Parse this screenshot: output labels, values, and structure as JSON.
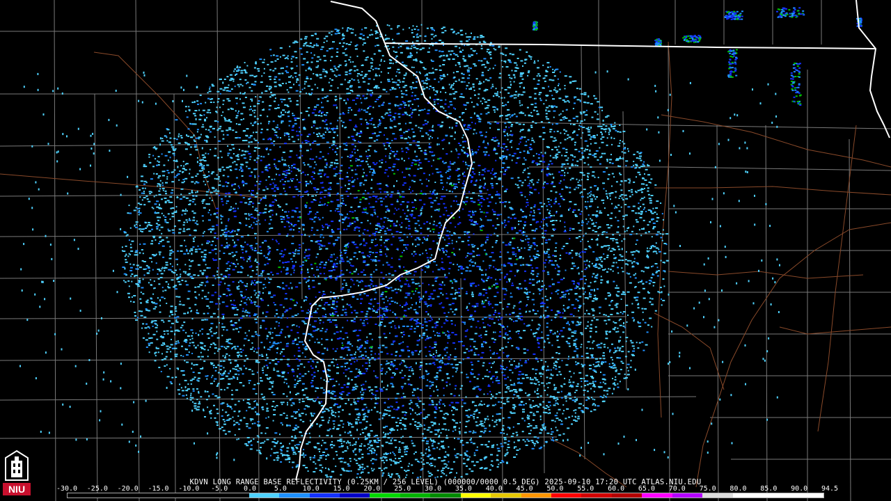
{
  "title": "KDVN LONG RANGE BASE REFLECTIVITY (0.25KM / 256 LEVEL) (000000/0000 0.5 DEG) 2025-09-10 17:20 UTC  ATLAS.NIU.EDU",
  "logo_text": "NIU",
  "colorbar": {
    "tick_labels": [
      "-30.0",
      "-25.0",
      "-20.0",
      "-15.0",
      "-10.0",
      "-5.0",
      "0.0",
      "5.0",
      "10.0",
      "15.0",
      "20.0",
      "25.0",
      "30.0",
      "35.0",
      "40.0",
      "45.0",
      "50.0",
      "55.0",
      "60.0",
      "65.0",
      "70.0",
      "75.0",
      "80.0",
      "85.0",
      "90.0",
      "94.5"
    ],
    "colors": [
      "#000000",
      "#000000",
      "#000000",
      "#000000",
      "#000000",
      "#000000",
      "#4fd2ff",
      "#1e90ff",
      "#1432ff",
      "#0000c8",
      "#00d800",
      "#00b400",
      "#008c00",
      "#ffff00",
      "#e6c800",
      "#ff9600",
      "#ff0000",
      "#d20000",
      "#b40000",
      "#ff00ff",
      "#b400ff",
      "#dcdcdc",
      "#ffffff",
      "#ffffff",
      "#ffffff"
    ]
  },
  "map": {
    "radar_site": {
      "name": "KDVN"
    },
    "echo_colors": [
      "#4fd2ff",
      "#2ab8f0",
      "#1e90ff",
      "#1e6eff",
      "#1432ff",
      "#00c000"
    ],
    "state_border_color": "#ffffff",
    "county_line_color": "#7a7a7a",
    "road_color": "#8a4a2a"
  }
}
